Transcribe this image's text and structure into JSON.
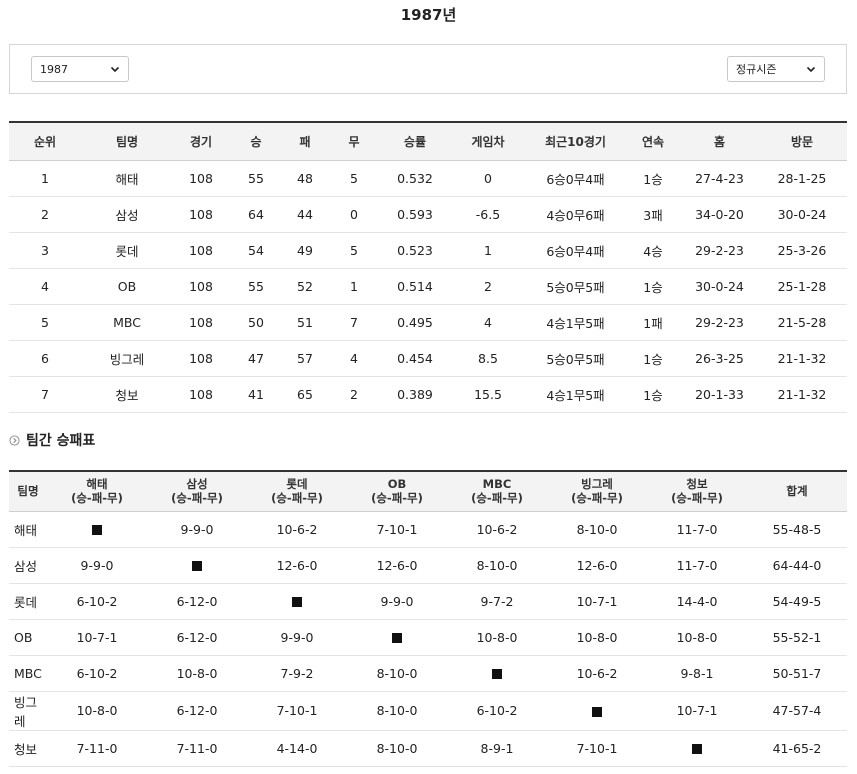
{
  "page": {
    "title": "1987년"
  },
  "filters": {
    "year": "1987",
    "season": "정규시즌"
  },
  "standings": {
    "headers": [
      "순위",
      "팀명",
      "경기",
      "승",
      "패",
      "무",
      "승률",
      "게임차",
      "최근10경기",
      "연속",
      "홈",
      "방문"
    ],
    "rows": [
      [
        "1",
        "해태",
        "108",
        "55",
        "48",
        "5",
        "0.532",
        "0",
        "6승0무4패",
        "1승",
        "27-4-23",
        "28-1-25"
      ],
      [
        "2",
        "삼성",
        "108",
        "64",
        "44",
        "0",
        "0.593",
        "-6.5",
        "4승0무6패",
        "3패",
        "34-0-20",
        "30-0-24"
      ],
      [
        "3",
        "롯데",
        "108",
        "54",
        "49",
        "5",
        "0.523",
        "1",
        "6승0무4패",
        "4승",
        "29-2-23",
        "25-3-26"
      ],
      [
        "4",
        "OB",
        "108",
        "55",
        "52",
        "1",
        "0.514",
        "2",
        "5승0무5패",
        "1승",
        "30-0-24",
        "25-1-28"
      ],
      [
        "5",
        "MBC",
        "108",
        "50",
        "51",
        "7",
        "0.495",
        "4",
        "4승1무5패",
        "1패",
        "29-2-23",
        "21-5-28"
      ],
      [
        "6",
        "빙그레",
        "108",
        "47",
        "57",
        "4",
        "0.454",
        "8.5",
        "5승0무5패",
        "1승",
        "26-3-25",
        "21-1-32"
      ],
      [
        "7",
        "청보",
        "108",
        "41",
        "65",
        "2",
        "0.389",
        "15.5",
        "4승1무5패",
        "1승",
        "20-1-33",
        "21-1-32"
      ]
    ]
  },
  "matrix": {
    "section_title": "팀간 승패표",
    "team_header": "팀명",
    "sub_label": "(승-패-무)",
    "columns": [
      "해태",
      "삼성",
      "롯데",
      "OB",
      "MBC",
      "빙그레",
      "청보"
    ],
    "total_header": "합계",
    "rows": [
      {
        "team": "해태",
        "cells": [
          "■",
          "9-9-0",
          "10-6-2",
          "7-10-1",
          "10-6-2",
          "8-10-0",
          "11-7-0"
        ],
        "total": "55-48-5"
      },
      {
        "team": "삼성",
        "cells": [
          "9-9-0",
          "■",
          "12-6-0",
          "12-6-0",
          "8-10-0",
          "12-6-0",
          "11-7-0"
        ],
        "total": "64-44-0"
      },
      {
        "team": "롯데",
        "cells": [
          "6-10-2",
          "6-12-0",
          "■",
          "9-9-0",
          "9-7-2",
          "10-7-1",
          "14-4-0"
        ],
        "total": "54-49-5"
      },
      {
        "team": "OB",
        "cells": [
          "10-7-1",
          "6-12-0",
          "9-9-0",
          "■",
          "10-8-0",
          "10-8-0",
          "10-8-0"
        ],
        "total": "55-52-1"
      },
      {
        "team": "MBC",
        "cells": [
          "6-10-2",
          "10-8-0",
          "7-9-2",
          "8-10-0",
          "■",
          "10-6-2",
          "9-8-1"
        ],
        "total": "50-51-7"
      },
      {
        "team": "빙그레",
        "cells": [
          "10-8-0",
          "6-12-0",
          "7-10-1",
          "8-10-0",
          "6-10-2",
          "■",
          "10-7-1"
        ],
        "total": "47-57-4"
      },
      {
        "team": "청보",
        "cells": [
          "7-11-0",
          "7-11-0",
          "4-14-0",
          "8-10-0",
          "8-9-1",
          "7-10-1",
          "■"
        ],
        "total": "41-65-2"
      }
    ]
  }
}
